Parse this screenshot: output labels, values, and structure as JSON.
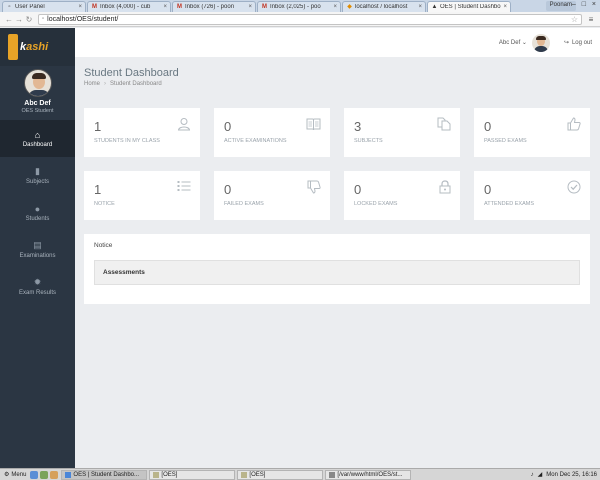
{
  "browser": {
    "tabs": [
      {
        "icon": "page-icon",
        "title": "User Panel",
        "active": false
      },
      {
        "icon": "gmail-icon",
        "title": "Inbox (4,000) - cub",
        "active": false
      },
      {
        "icon": "gmail-icon",
        "title": "Inbox (726) - poon",
        "active": false
      },
      {
        "icon": "gmail-icon",
        "title": "Inbox (2,025) - poo",
        "active": false
      },
      {
        "icon": "db-icon",
        "title": "localhost / localhost",
        "active": false
      },
      {
        "icon": "grad-cap-icon",
        "title": "OES | Student Dashbo",
        "active": true
      }
    ],
    "user_chip": "Poonam",
    "url": "localhost/OES/student/"
  },
  "sidebar": {
    "logo_k": "k",
    "logo_text": "ashi",
    "profile_name": "Abc Def",
    "profile_role": "OES Student",
    "items": [
      {
        "label": "Dashboard",
        "icon": "home-icon",
        "active": true
      },
      {
        "label": "Subjects",
        "icon": "file-icon",
        "active": false
      },
      {
        "label": "Students",
        "icon": "user-icon",
        "active": false
      },
      {
        "label": "Examinations",
        "icon": "book-icon",
        "active": false
      },
      {
        "label": "Exam Results",
        "icon": "gear-icon",
        "active": false
      }
    ]
  },
  "topbar": {
    "user_name": "Abc Def",
    "logout_label": "Log out"
  },
  "main": {
    "title": "Student Dashboard",
    "breadcrumb": [
      "Home",
      "Student Dashboard"
    ],
    "cards": [
      {
        "value": "1",
        "label": "STUDENTS IN MY CLASS",
        "icon": "user-icon"
      },
      {
        "value": "0",
        "label": "ACTIVE EXAMINATIONS",
        "icon": "book-icon"
      },
      {
        "value": "3",
        "label": "SUBJECTS",
        "icon": "files-icon"
      },
      {
        "value": "0",
        "label": "PASSED EXAMS",
        "icon": "thumbs-up-icon"
      },
      {
        "value": "1",
        "label": "NOTICE",
        "icon": "list-icon"
      },
      {
        "value": "0",
        "label": "FAILED EXAMS",
        "icon": "thumbs-down-icon"
      },
      {
        "value": "0",
        "label": "LOCKED EXAMS",
        "icon": "lock-icon"
      },
      {
        "value": "0",
        "label": "ATTENDED EXAMS",
        "icon": "check-circle-icon"
      }
    ],
    "notice_title": "Notice",
    "notice_item": "Assessments"
  },
  "taskbar": {
    "menu_label": "Menu",
    "windows": [
      {
        "title": "OES | Student Dashbo...",
        "active": true
      },
      {
        "title": "[OES]",
        "active": false
      },
      {
        "title": "[OES]",
        "active": false
      },
      {
        "title": "[/var/www/html/OES/st...",
        "active": false
      }
    ],
    "clock": "Mon Dec 25, 16:16"
  }
}
